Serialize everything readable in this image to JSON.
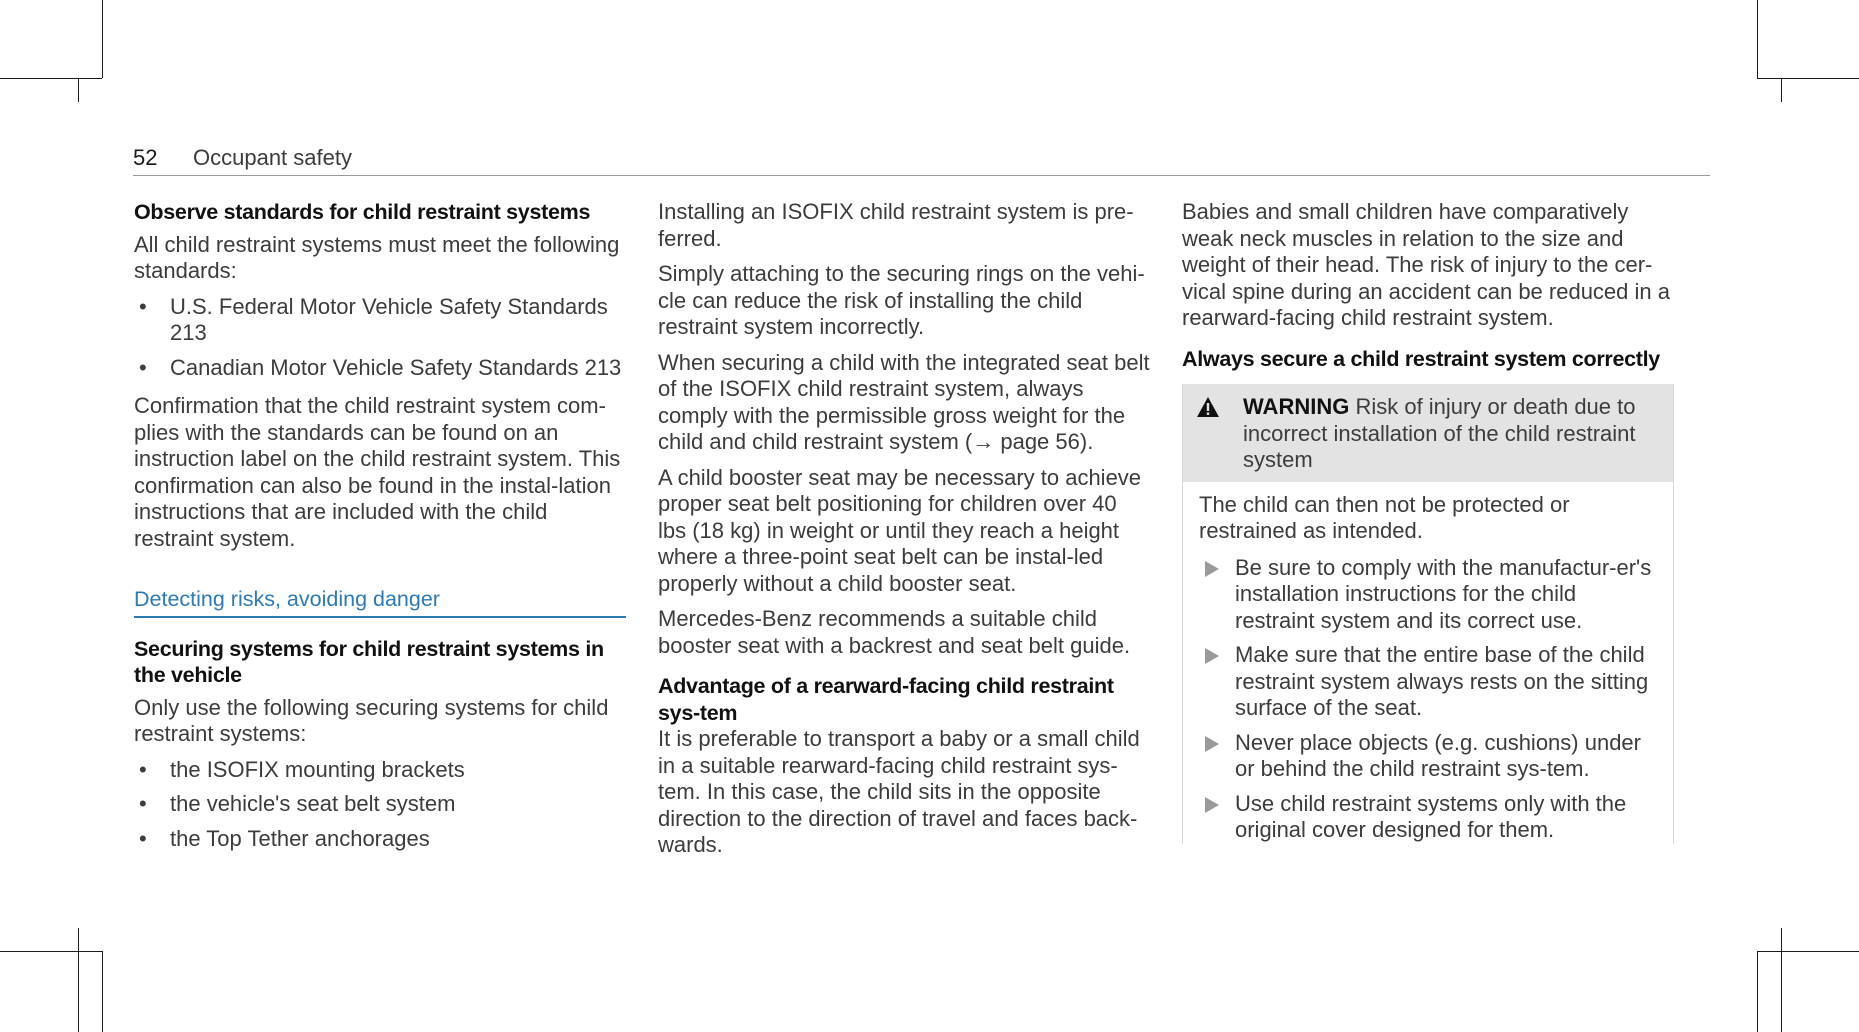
{
  "header": {
    "page_number": "52",
    "section": "Occupant safety"
  },
  "col1": {
    "h_standards": "Observe standards for child restraint systems",
    "p_standards": "All child restraint systems must meet the following standards:",
    "standards": [
      "U.S. Federal Motor Vehicle Safety Standards 213",
      "Canadian Motor Vehicle Safety Standards 213"
    ],
    "p_confirmation": "Confirmation that the child restraint system com-plies with the standards can be found on an instruction label on the child restraint system. This confirmation can also be found in the instal-lation instructions that are included with the child restraint system.",
    "section_title": "Detecting risks, avoiding danger",
    "h_securing": "Securing systems for child restraint systems in the vehicle",
    "p_securing": "Only use the following securing systems for child restraint systems:",
    "securing": [
      "the ISOFIX mounting brackets",
      "the vehicle's seat belt system",
      "the Top Tether anchorages"
    ]
  },
  "col2": {
    "p1": "Installing an ISOFIX child restraint system is pre-ferred.",
    "p2": "Simply attaching to the securing rings on the vehi-cle can reduce the risk of installing the child restraint system incorrectly.",
    "p3": "When securing a child with the integrated seat belt of the ISOFIX child restraint system, always comply with the permissible gross weight for the child and child restraint system (→ page 56).",
    "p4": "A child booster seat may be necessary to achieve proper seat belt positioning for children over 40 lbs (18 kg) in weight or until they reach a height where a three-point seat belt can be instal-led properly without a child booster seat.",
    "p5": "Mercedes-Benz recommends a suitable child booster seat with a backrest and seat belt guide.",
    "h_rearward": "Advantage of a rearward-facing child restraint sys-tem",
    "p6": "It is preferable to transport a baby or a small child in a suitable rearward-facing child restraint sys-tem. In this case, the child sits in the opposite direction to the direction of travel and faces back-wards."
  },
  "col3": {
    "p1": "Babies and small children have comparatively weak neck muscles in relation to the size and weight of their head. The risk of injury to the cer-vical spine during an accident can be reduced in a rearward-facing child restraint system.",
    "h_secure": "Always secure a child restraint system correctly",
    "warning": {
      "icon": "warning-triangle-icon",
      "label": "WARNING",
      "text": " Risk of injury or death due to incorrect installation of the child restraint system",
      "body": "The child can then not be protected or restrained as intended.",
      "steps": [
        "Be sure to comply with the manufactur-er's installation instructions for the child restraint system and its correct use.",
        "Make sure that the entire base of the child restraint system always rests on the sitting surface of the seat.",
        "Never place objects (e.g. cushions) under or behind the child restraint sys-tem.",
        "Use child restraint systems only with the original cover designed for them."
      ]
    }
  }
}
